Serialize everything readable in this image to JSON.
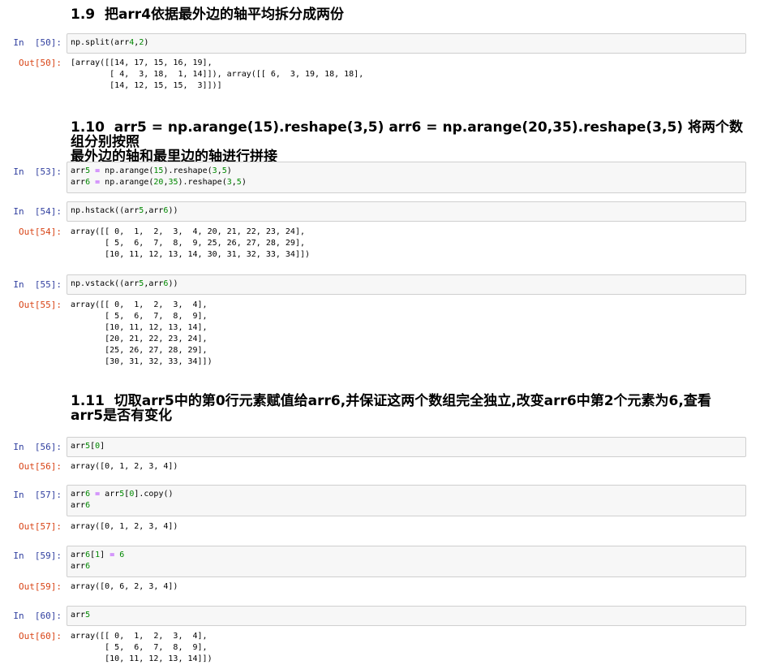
{
  "sections": [
    {
      "heading": "1.9  把arr4依据最外边的轴平均拆分成两份"
    },
    {
      "heading": "1.10  arr5 = np.arange(15).reshape(3,5) arr6 = np.arange(20,35).reshape(3,5) 将两个数组分别按照\n最外边的轴和最里边的轴进行拼接"
    },
    {
      "heading": "1.11  切取arr5中的第0行元素赋值给arr6,并保证这两个数组完全独立,改变arr6中第2个元素为6,查看\narr5是否有变化"
    }
  ],
  "cells": [
    {
      "in_prompt": "In  [50]:",
      "code": [
        "np.split(arr4,2)"
      ],
      "out_prompt": "Out[50]:",
      "output": "[array([[14, 17, 15, 16, 19],\n        [ 4,  3, 18,  1, 14]]), array([[ 6,  3, 19, 18, 18],\n        [14, 12, 15, 15,  3]])]"
    },
    {
      "in_prompt": "In  [53]:",
      "code": [
        "arr5 = np.arange(15).reshape(3,5)",
        "arr6 = np.arange(20,35).reshape(3,5)"
      ],
      "out_prompt": "",
      "output": ""
    },
    {
      "in_prompt": "In  [54]:",
      "code": [
        "np.hstack((arr5,arr6))"
      ],
      "out_prompt": "Out[54]:",
      "output": "array([[ 0,  1,  2,  3,  4, 20, 21, 22, 23, 24],\n       [ 5,  6,  7,  8,  9, 25, 26, 27, 28, 29],\n       [10, 11, 12, 13, 14, 30, 31, 32, 33, 34]])"
    },
    {
      "in_prompt": "In  [55]:",
      "code": [
        "np.vstack((arr5,arr6))"
      ],
      "out_prompt": "Out[55]:",
      "output": "array([[ 0,  1,  2,  3,  4],\n       [ 5,  6,  7,  8,  9],\n       [10, 11, 12, 13, 14],\n       [20, 21, 22, 23, 24],\n       [25, 26, 27, 28, 29],\n       [30, 31, 32, 33, 34]])"
    },
    {
      "in_prompt": "In  [56]:",
      "code": [
        "arr5[0]"
      ],
      "out_prompt": "Out[56]:",
      "output": "array([0, 1, 2, 3, 4])"
    },
    {
      "in_prompt": "In  [57]:",
      "code": [
        "arr6 = arr5[0].copy()",
        "arr6"
      ],
      "out_prompt": "Out[57]:",
      "output": "array([0, 1, 2, 3, 4])"
    },
    {
      "in_prompt": "In  [59]:",
      "code": [
        "arr6[1] = 6",
        "arr6"
      ],
      "out_prompt": "Out[59]:",
      "output": "array([0, 6, 2, 3, 4])"
    },
    {
      "in_prompt": "In  [60]:",
      "code": [
        "arr5"
      ],
      "out_prompt": "Out[60]:",
      "output": "array([[ 0,  1,  2,  3,  4],\n       [ 5,  6,  7,  8,  9],\n       [10, 11, 12, 13, 14]])"
    }
  ],
  "colors": {
    "in_prompt": "#303f9f",
    "out_prompt": "#d84315",
    "input_bg": "#f7f7f7",
    "input_border": "#cfcfcf",
    "number_token": "#008800",
    "operator_token": "#aa22ff"
  }
}
